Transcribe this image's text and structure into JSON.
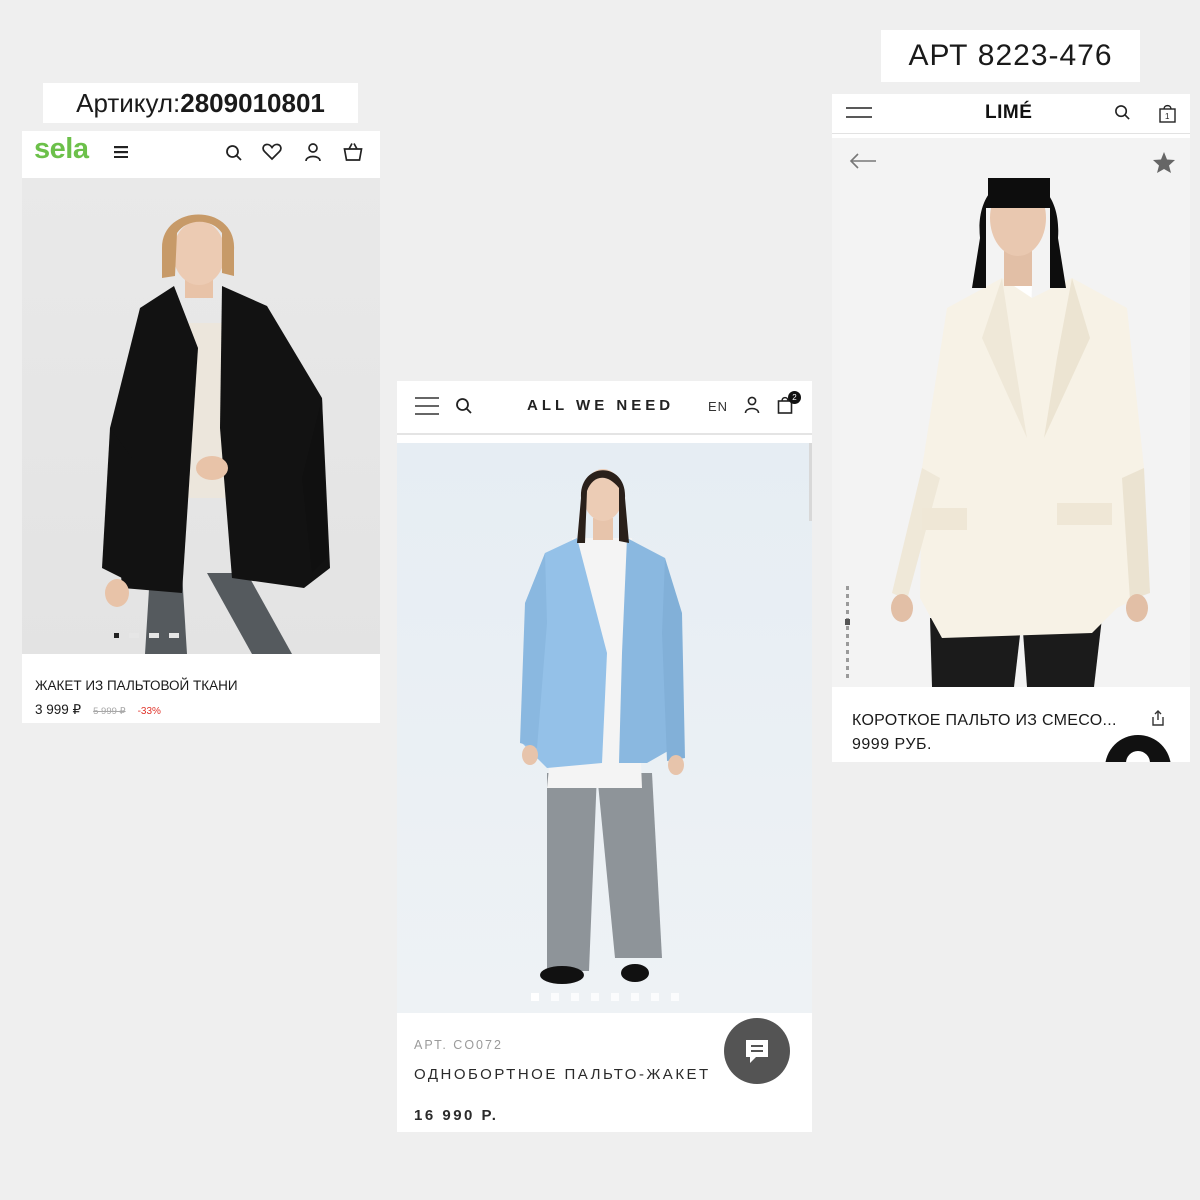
{
  "labels": {
    "sela_article_prefix": "Артикул: ",
    "sela_article_number": "2809010801",
    "lime_article": "АРТ 8223-476"
  },
  "sela": {
    "logo": "sela",
    "menu_icon": "hamburger-icon",
    "icons": [
      "search-icon",
      "heart-icon",
      "user-icon",
      "basket-icon"
    ],
    "product_title": "ЖАКЕТ ИЗ ПАЛЬТОВОЙ ТКАНИ",
    "price": "3 999 ₽",
    "old_price": "5 999 ₽",
    "discount": "-33%",
    "colors": {
      "brand": "#6cc04a",
      "discount": "#e0342b"
    }
  },
  "awn": {
    "logo": "ALL WE NEED",
    "lang": "EN",
    "cart_count": "2",
    "article": "АРТ. CO072",
    "product_title": "ОДНОБОРТНОЕ ПАЛЬТО-ЖАКЕТ",
    "price": "16 990 Р.",
    "chat_icon": "chat-bubble-icon"
  },
  "lime": {
    "logo": "LIMÉ",
    "cart_count": "1",
    "product_title": "КОРОТКОЕ ПАЛЬТО ИЗ СМЕСО...",
    "price": "9999 РУБ.",
    "icons": [
      "back-arrow-icon",
      "star-icon",
      "share-icon"
    ]
  }
}
